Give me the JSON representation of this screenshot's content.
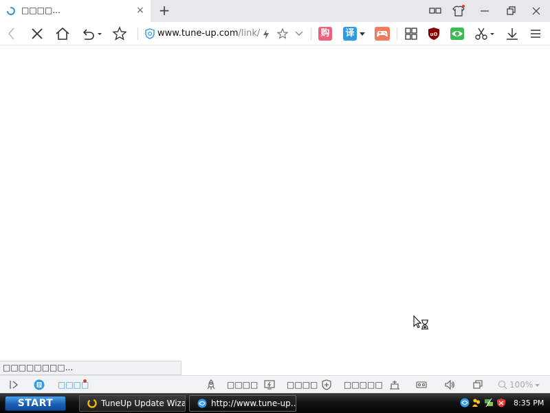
{
  "tab": {
    "title": "□□□□...",
    "close_glyph": "×",
    "new_tab_glyph": "+"
  },
  "toolbar": {
    "address": {
      "host": "www.tune-up.com",
      "path": "/link/?"
    },
    "extensions": [
      {
        "name": "shopping",
        "glyph": "购",
        "color": "#f0607a"
      },
      {
        "name": "translate",
        "glyph": "译",
        "color": "#2e9be6"
      },
      {
        "name": "game",
        "glyph": "",
        "color": "#f07a5a"
      }
    ]
  },
  "status_bubble": "□□□□□□□□...",
  "statusbar": {
    "sidebar_label": "□□□□",
    "item1": "□□□□",
    "item2": "□□□□",
    "item3": "□□□□□",
    "zoom": "100%"
  },
  "taskbar": {
    "start_label": "START",
    "items": [
      {
        "label": "TuneUp Update Wizard"
      },
      {
        "label": "http://www.tune-up..."
      }
    ],
    "clock": "8:35 PM"
  },
  "colors": {
    "accent": "#2e9be6",
    "tab_bg": "#e6e8ec",
    "taskbar": "#111111",
    "start": "#1b5fb8"
  }
}
